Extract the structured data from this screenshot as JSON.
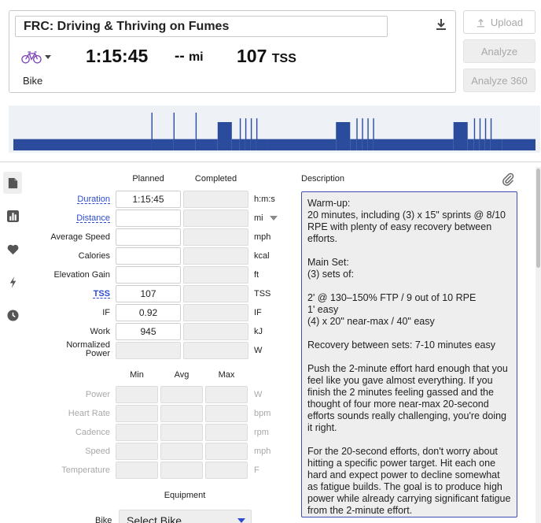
{
  "header": {
    "title": "FRC: Driving & Thriving on Fumes",
    "sport_label": "Bike",
    "duration": "1:15:45",
    "distance_value": "--",
    "distance_unit": "mi",
    "tss_value": "107",
    "tss_unit": "TSS"
  },
  "actions": {
    "upload": "Upload",
    "analyze": "Analyze",
    "analyze360": "Analyze 360"
  },
  "graph_segments": [
    {
      "start": 0,
      "end": 175,
      "level": 0.3
    },
    {
      "start": 175,
      "end": 176,
      "level": 1.0
    },
    {
      "start": 176,
      "end": 203,
      "level": 0.3
    },
    {
      "start": 203,
      "end": 204,
      "level": 1.0
    },
    {
      "start": 204,
      "end": 231,
      "level": 0.3
    },
    {
      "start": 231,
      "end": 232,
      "level": 1.0
    },
    {
      "start": 232,
      "end": 259,
      "level": 0.3
    },
    {
      "start": 259,
      "end": 277,
      "level": 0.75
    },
    {
      "start": 277,
      "end": 287,
      "level": 0.3
    },
    {
      "start": 287,
      "end": 288,
      "level": 0.85
    },
    {
      "start": 288,
      "end": 294,
      "level": 0.3
    },
    {
      "start": 294,
      "end": 295,
      "level": 0.85
    },
    {
      "start": 295,
      "end": 301,
      "level": 0.3
    },
    {
      "start": 301,
      "end": 302,
      "level": 0.85
    },
    {
      "start": 302,
      "end": 308,
      "level": 0.3
    },
    {
      "start": 308,
      "end": 309,
      "level": 0.85
    },
    {
      "start": 309,
      "end": 322,
      "level": 0.3
    },
    {
      "start": 322,
      "end": 409,
      "level": 0.3
    },
    {
      "start": 409,
      "end": 427,
      "level": 0.75
    },
    {
      "start": 427,
      "end": 435,
      "level": 0.3
    },
    {
      "start": 435,
      "end": 436,
      "level": 0.85
    },
    {
      "start": 436,
      "end": 442,
      "level": 0.3
    },
    {
      "start": 442,
      "end": 443,
      "level": 0.85
    },
    {
      "start": 443,
      "end": 449,
      "level": 0.3
    },
    {
      "start": 449,
      "end": 450,
      "level": 0.85
    },
    {
      "start": 450,
      "end": 456,
      "level": 0.3
    },
    {
      "start": 456,
      "end": 457,
      "level": 0.85
    },
    {
      "start": 457,
      "end": 558,
      "level": 0.3
    },
    {
      "start": 558,
      "end": 576,
      "level": 0.75
    },
    {
      "start": 576,
      "end": 584,
      "level": 0.3
    },
    {
      "start": 584,
      "end": 585,
      "level": 0.85
    },
    {
      "start": 585,
      "end": 591,
      "level": 0.3
    },
    {
      "start": 591,
      "end": 592,
      "level": 0.85
    },
    {
      "start": 592,
      "end": 598,
      "level": 0.3
    },
    {
      "start": 598,
      "end": 599,
      "level": 0.85
    },
    {
      "start": 599,
      "end": 605,
      "level": 0.3
    },
    {
      "start": 605,
      "end": 606,
      "level": 0.85
    },
    {
      "start": 606,
      "end": 620,
      "level": 0.3
    },
    {
      "start": 620,
      "end": 662,
      "level": 0.3
    }
  ],
  "form": {
    "col_planned": "Planned",
    "col_completed": "Completed",
    "rows": {
      "duration": {
        "label": "Duration",
        "planned": "1:15:45",
        "unit": "h:m:s"
      },
      "distance": {
        "label": "Distance",
        "planned": "",
        "unit": "mi"
      },
      "avg_speed": {
        "label": "Average Speed",
        "planned": "",
        "unit": "mph"
      },
      "calories": {
        "label": "Calories",
        "planned": "",
        "unit": "kcal"
      },
      "elevation": {
        "label": "Elevation Gain",
        "planned": "",
        "unit": "ft"
      },
      "tss": {
        "label": "TSS",
        "planned": "107",
        "unit": "TSS"
      },
      "if": {
        "label": "IF",
        "planned": "0.92",
        "unit": "IF"
      },
      "work": {
        "label": "Work",
        "planned": "945",
        "unit": "kJ"
      },
      "np": {
        "label_line1": "Normalized",
        "label_line2": "Power",
        "unit": "W"
      }
    },
    "col_min": "Min",
    "col_avg": "Avg",
    "col_max": "Max",
    "mam_rows": {
      "power": {
        "label": "Power",
        "unit": "W"
      },
      "heart_rate": {
        "label": "Heart Rate",
        "unit": "bpm"
      },
      "cadence": {
        "label": "Cadence",
        "unit": "rpm"
      },
      "speed": {
        "label": "Speed",
        "unit": "mph"
      },
      "temperature": {
        "label": "Temperature",
        "unit": "F"
      }
    },
    "equipment_heading": "Equipment",
    "bike_label": "Bike",
    "bike_select": "Select Bike"
  },
  "description": {
    "label": "Description",
    "paragraphs": [
      "Warm-up:\n20 minutes, including (3) x 15\" sprints @ 8/10 RPE with plenty of easy recovery between efforts.",
      "Main Set:\n(3) sets of:",
      "2' @ 130–150% FTP / 9 out of 10 RPE\n1' easy\n(4) x 20\" near-max / 40\" easy",
      "Recovery between sets: 7-10 minutes easy",
      "Push the 2-minute effort hard enough that you feel like you gave almost everything. If you finish the 2 minutes feeling gassed and the thought of four more near-max 20-second efforts sounds really challenging, you're doing it right.",
      "For the 20-second efforts, don't worry about hitting a specific power target. Hit each one hard and expect power to decline somewhat as fatigue builds. The goal is to produce high power while already carrying significant fatigue from the 2-minute effort."
    ]
  },
  "colors": {
    "accent": "#2c4bd1",
    "graph_fill": "#2b4c9c",
    "graph_bg": "#eef1f6",
    "bike_icon": "#7b3fb8"
  }
}
